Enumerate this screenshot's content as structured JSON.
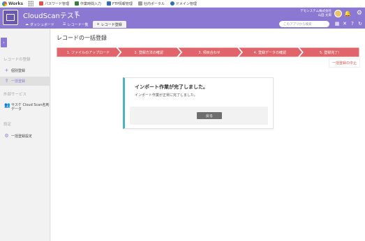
{
  "topbar": {
    "brand": "Works",
    "links": [
      {
        "label": "パスワード管理",
        "icon": "key-icon",
        "color": "#d9534f"
      },
      {
        "label": "作業時間入力",
        "icon": "clock-icon",
        "color": "#3a7d44"
      },
      {
        "label": "FTP情報管理",
        "icon": "ftp-icon",
        "color": "#2f6db5"
      },
      {
        "label": "社内ポータル",
        "icon": "portal-icon",
        "color": "#9e9e9e"
      },
      {
        "label": "ドメイン管理",
        "icon": "domain-icon",
        "color": "#2f6db5"
      }
    ]
  },
  "header": {
    "app_title": "CloudScanテスト",
    "app_title_sub": "🗑",
    "company_name": "デモシステム株式会社",
    "user_name": "山田 太郎",
    "search_placeholder": "このアプリから検索",
    "tabs": [
      {
        "label": "ダッシュボード",
        "icon": "cloud-icon"
      },
      {
        "label": "レコード一覧",
        "icon": "list-icon"
      },
      {
        "label": "レコード登録",
        "icon": "plus-icon",
        "active": true
      }
    ],
    "accent_color": "#8b78d3"
  },
  "sidebar": {
    "sections": [
      {
        "title": "レコードの登録",
        "items": [
          {
            "label": "個別登録",
            "icon": "plus-icon"
          },
          {
            "label": "一括登録",
            "icon": "upload-icon",
            "active": true
          }
        ]
      },
      {
        "title": "外部サービス",
        "items": [
          {
            "label": "サスケ Cloud Scan名刺データ",
            "icon": "people-icon"
          }
        ]
      },
      {
        "title": "設定",
        "items": [
          {
            "label": "一括登録設定",
            "icon": "gear-icon"
          }
        ]
      }
    ]
  },
  "main": {
    "page_title": "レコードの一括登録",
    "steps": [
      "1. ファイルのアップロード",
      "2. 登録方法の確認",
      "3. 項目合わせ",
      "4. 登録データの確認",
      "5. 登録完了！"
    ],
    "step_color": "#e06469",
    "cancel_label": "一括登録の中止",
    "card": {
      "title": "インポート作業が完了しました。",
      "message": "インポート作業が正常に完了しました。",
      "back_label": "戻る",
      "accent_color": "#4fb3bf"
    }
  }
}
